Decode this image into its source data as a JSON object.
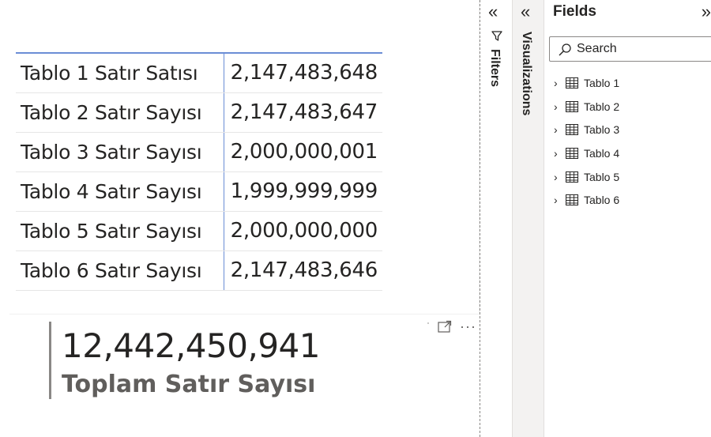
{
  "table": {
    "rows": [
      {
        "label": "Tablo 1 Satır Satısı",
        "value": "2,147,483,648"
      },
      {
        "label": "Tablo 2 Satır Sayısı",
        "value": "2,147,483,647"
      },
      {
        "label": "Tablo 3 Satır Sayısı",
        "value": "2,000,000,001"
      },
      {
        "label": "Tablo 4 Satır Sayısı",
        "value": "1,999,999,999"
      },
      {
        "label": "Tablo 5 Satır Sayısı",
        "value": "2,000,000,000"
      },
      {
        "label": "Tablo 6 Satır Sayısı",
        "value": "2,147,483,646"
      }
    ]
  },
  "card": {
    "value": "12,442,450,941",
    "label": "Toplam Satır Sayısı",
    "icons": [
      "focus-mode-icon",
      "more-options-icon"
    ]
  },
  "filters_pane": {
    "label": "Filters",
    "collapse_glyph": "«",
    "icon": "filter-icon"
  },
  "visualizations_pane": {
    "label": "Visualizations",
    "collapse_glyph": "«"
  },
  "fields_pane": {
    "title": "Fields",
    "expand_glyph": "»",
    "search": {
      "placeholder": "Search",
      "value": ""
    },
    "items": [
      {
        "name": "Tablo 1"
      },
      {
        "name": "Tablo 2"
      },
      {
        "name": "Tablo 3"
      },
      {
        "name": "Tablo 4"
      },
      {
        "name": "Tablo 5"
      },
      {
        "name": "Tablo 6"
      }
    ]
  },
  "colors": {
    "accent_blue": "#6b8dd6",
    "text": "#252423",
    "card_bar": "#8a8886",
    "pane_gray": "#f3f2f1"
  }
}
